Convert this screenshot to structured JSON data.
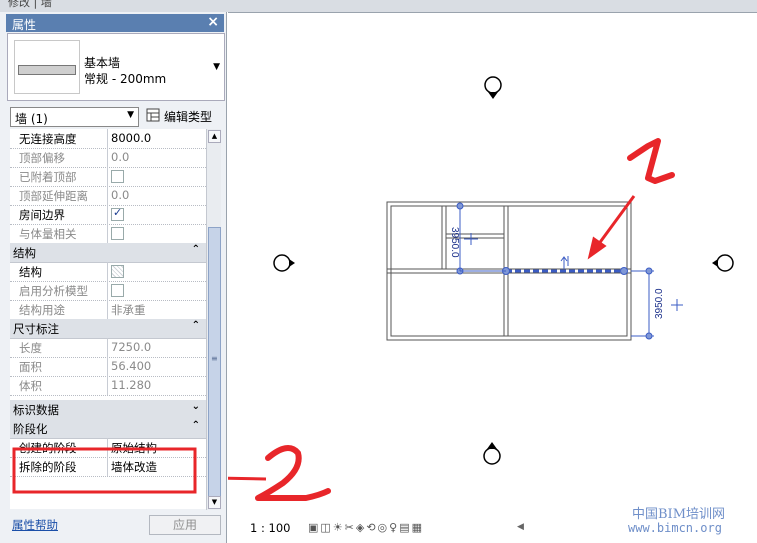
{
  "window": {
    "title_fragment": "修改 | 墙"
  },
  "properties": {
    "title": "属性",
    "close": "×",
    "type_name_1": "基本墙",
    "type_name_2": "常规 - 200mm",
    "instance_selector": "墙 (1)",
    "edit_type_label": "编辑类型",
    "groups": {
      "structure": "结构",
      "dimensions": "尺寸标注",
      "identity": "标识数据",
      "phasing": "阶段化"
    },
    "rows": {
      "unconnected_height": {
        "label": "无连接高度",
        "value": "8000.0"
      },
      "top_offset": {
        "label": "顶部偏移",
        "value": "0.0"
      },
      "top_attached": {
        "label": "已附着顶部"
      },
      "top_extension": {
        "label": "顶部延伸距离",
        "value": "0.0"
      },
      "room_bounding": {
        "label": "房间边界"
      },
      "related_to_mass": {
        "label": "与体量相关"
      },
      "structural": {
        "label": "结构"
      },
      "enable_analytical": {
        "label": "启用分析模型"
      },
      "structural_usage": {
        "label": "结构用途",
        "value": "非承重"
      },
      "length": {
        "label": "长度",
        "value": "7250.0"
      },
      "area": {
        "label": "面积",
        "value": "56.400"
      },
      "volume": {
        "label": "体积",
        "value": "11.280"
      },
      "phase_created": {
        "label": "创建的阶段",
        "value": "原始结构"
      },
      "phase_demolished": {
        "label": "拆除的阶段",
        "value": "墙体改造"
      }
    },
    "help_link": "属性帮助",
    "apply_button": "应用"
  },
  "canvas": {
    "dim_top": "3950.0",
    "dim_right": "3950.0",
    "annotation_1": "1",
    "annotation_2": "2",
    "annotation_color": "#e8262a",
    "highlight_color": "#3b5cc4"
  },
  "status_bar": {
    "scale": "1 : 100"
  },
  "watermark": {
    "line1": "中国BIM培训网",
    "line2": "www.bimcn.org"
  }
}
